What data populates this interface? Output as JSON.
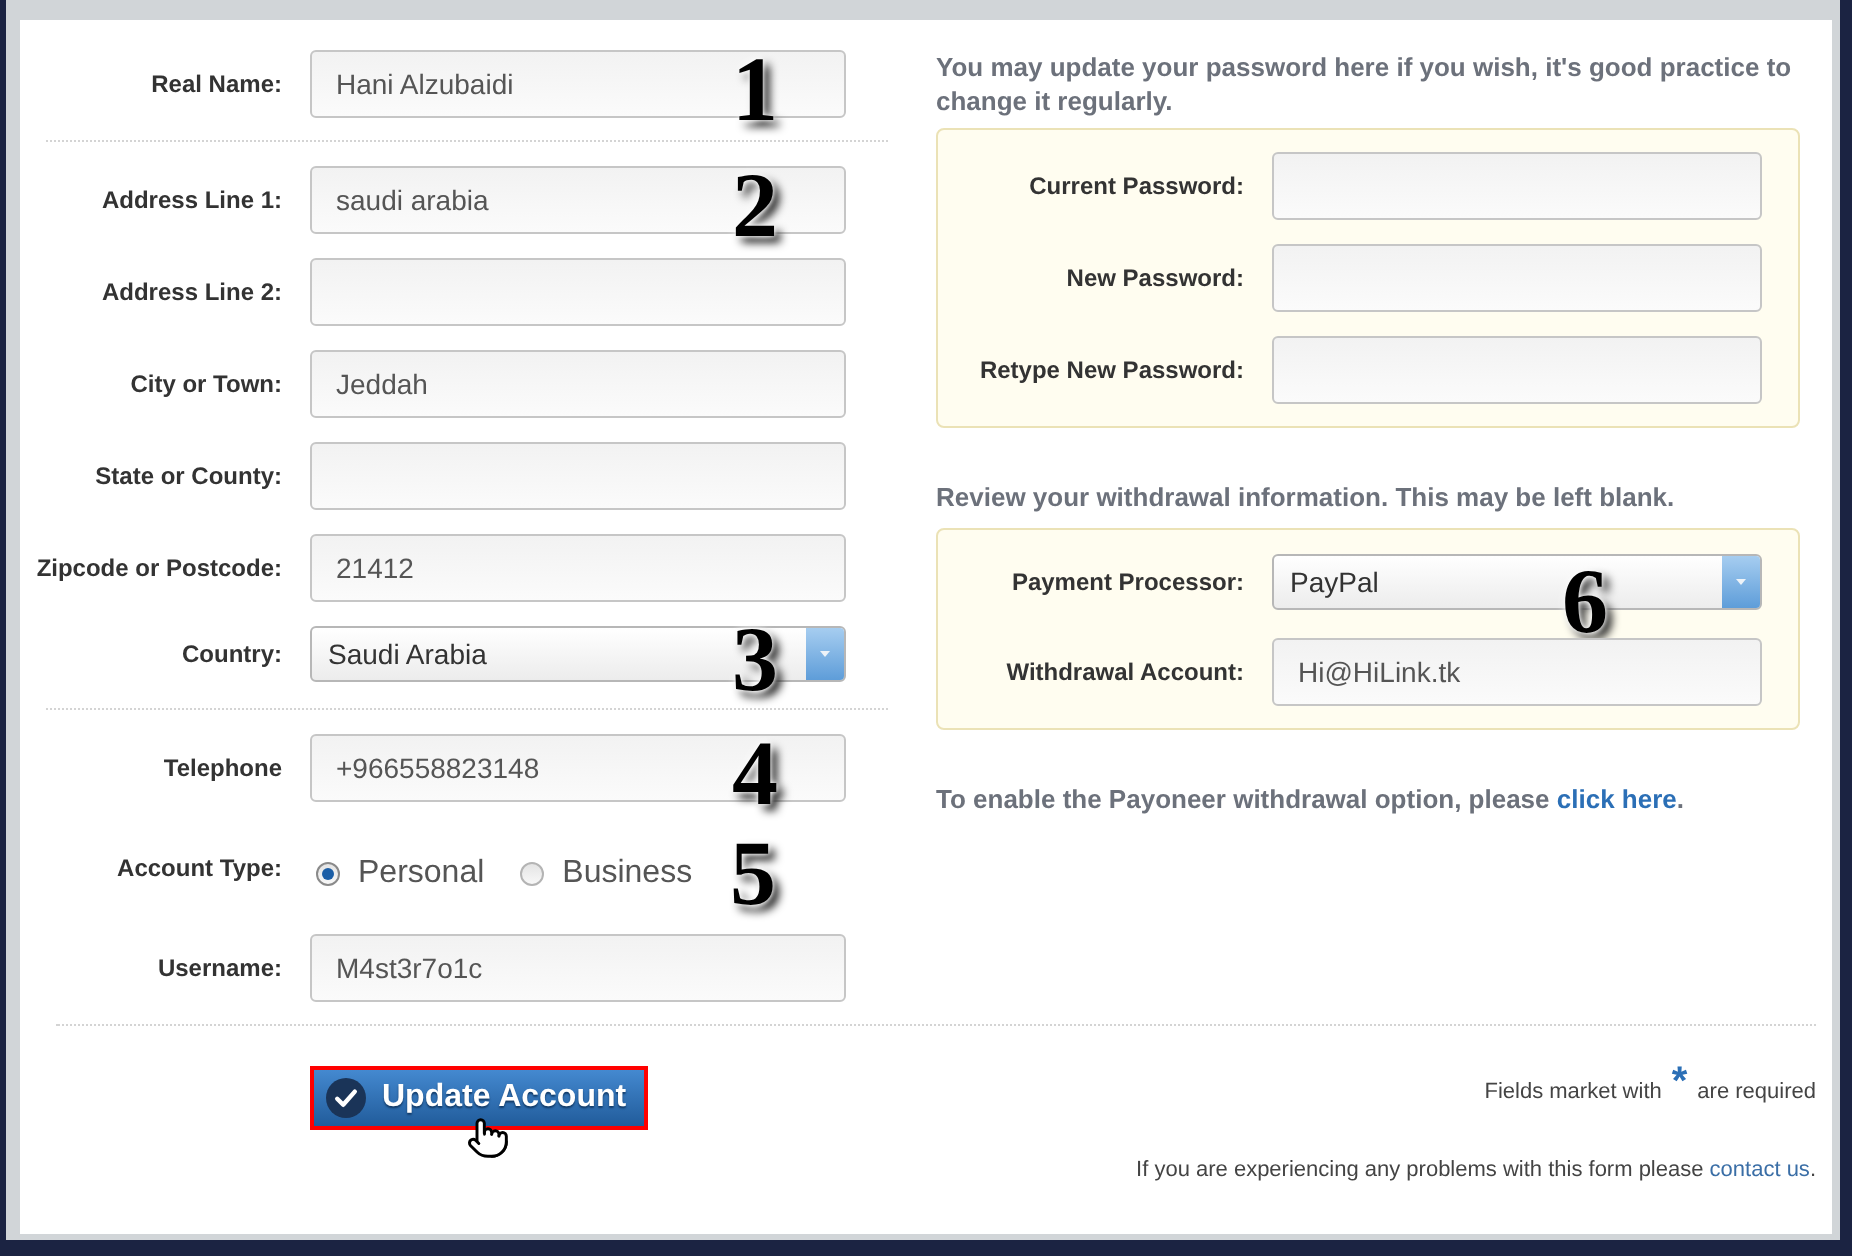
{
  "profile_form": {
    "sections": [
      {
        "rows": [
          {
            "kind": "text",
            "label": "Real Name:",
            "value": "Hani Alzubaidi",
            "annotation": "1"
          }
        ]
      },
      {
        "rows": [
          {
            "kind": "text",
            "label": "Address Line 1:",
            "value": "saudi arabia",
            "annotation": "2"
          },
          {
            "kind": "text",
            "label": "Address Line 2:"
          },
          {
            "kind": "text",
            "label": "City or Town:",
            "value": "Jeddah"
          },
          {
            "kind": "text",
            "label": "State or County:"
          },
          {
            "kind": "text",
            "label": "Zipcode or Postcode:",
            "value": "21412"
          },
          {
            "kind": "select",
            "label": "Country:",
            "value": "Saudi Arabia",
            "annotation": "3"
          }
        ]
      },
      {
        "rows": [
          {
            "kind": "text",
            "label": "Telephone",
            "value": "+966558823148",
            "annotation": "4"
          },
          {
            "kind": "radio",
            "label": "Account Type:",
            "options": [
              {
                "label": "Personal",
                "selected": true
              },
              {
                "label": "Business",
                "selected": false
              }
            ],
            "annotation": "5"
          },
          {
            "kind": "text",
            "label": "Username:",
            "value": "M4st3r7o1c"
          }
        ]
      }
    ]
  },
  "password_section": {
    "intro": "You may update your password here if you wish, it's good practice to change it regularly.",
    "fields": [
      {
        "kind": "password",
        "label": "Current Password:"
      },
      {
        "kind": "password",
        "label": "New Password:"
      },
      {
        "kind": "password",
        "label": "Retype New Password:"
      }
    ]
  },
  "withdrawal_section": {
    "intro": "Review your withdrawal information. This may be left blank.",
    "fields": [
      {
        "kind": "select",
        "label": "Payment Processor:",
        "value": "PayPal",
        "annotation": "6"
      },
      {
        "kind": "text",
        "label": "Withdrawal Account:",
        "value": "Hi@HiLink.tk"
      }
    ]
  },
  "payoneer_note": {
    "text": "To enable the Payoneer withdrawal option, please",
    "link": "click here",
    "end": "."
  },
  "footer": {
    "button": {
      "label": "Update Account",
      "highlighted": true
    },
    "required_note": {
      "before": "Fields market with",
      "mark": "*",
      "after": "are required"
    },
    "help_note": {
      "text": "If you are experiencing any problems with this form please",
      "link": "contact us",
      "end": "."
    }
  }
}
